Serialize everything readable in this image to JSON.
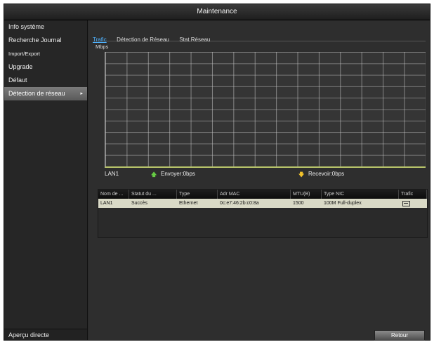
{
  "window": {
    "title": "Maintenance"
  },
  "sidebar": {
    "items": [
      {
        "label": "Info système"
      },
      {
        "label": "Recherche Journal"
      },
      {
        "label": "Import/Export"
      },
      {
        "label": "Upgrade"
      },
      {
        "label": "Défaut"
      },
      {
        "label": "Détection de réseau"
      }
    ],
    "active_arrow": "▸",
    "footer": "Aperçu directe"
  },
  "tabs": [
    {
      "label": "Trafic",
      "active": true
    },
    {
      "label": "Détection de Réseau"
    },
    {
      "label": "Stat.Réseau"
    }
  ],
  "graph": {
    "unit": "Mbps",
    "legend": {
      "interface": "LAN1",
      "send": "Envoyer:0bps",
      "receive": "Recevoir:0bps"
    },
    "colors": {
      "send": "#66cc44",
      "receive": "#f2c22b",
      "baseline": "#b8c46a"
    }
  },
  "table": {
    "headers": [
      "Nom de ...",
      "Statut du ...",
      "Type",
      "Adr MAC",
      "MTU(B)",
      "Type NIC",
      "Trafic"
    ],
    "rows": [
      [
        "LAN1",
        "Succès",
        "Ethernet",
        "0c:e7:46:2b:c0:8a",
        "1500",
        "100M Full-duplex",
        ""
      ]
    ]
  },
  "buttons": {
    "retour": "Retour"
  }
}
